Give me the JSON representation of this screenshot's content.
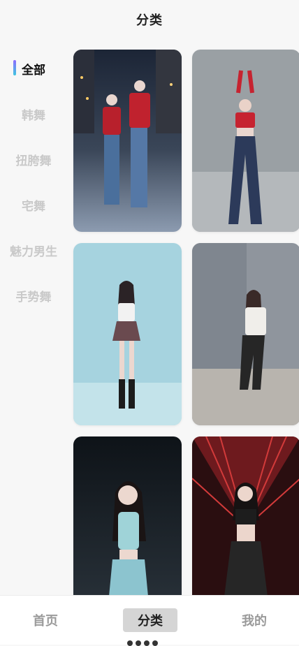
{
  "header": {
    "title": "分类"
  },
  "sidebar": {
    "items": [
      {
        "label": "全部",
        "active": true
      },
      {
        "label": "韩舞",
        "active": false
      },
      {
        "label": "扭胯舞",
        "active": false
      },
      {
        "label": "宅舞",
        "active": false
      },
      {
        "label": "魅力男生",
        "active": false
      },
      {
        "label": "手势舞",
        "active": false
      }
    ]
  },
  "grid": {
    "cards": [
      {
        "scene": "two-dancers-street-night"
      },
      {
        "scene": "dancer-red-top-grey-wall"
      },
      {
        "scene": "dancer-plaid-skirt-blue-backdrop"
      },
      {
        "scene": "dancer-white-top-grey-room"
      },
      {
        "scene": "dancer-teal-outfit-dark-stage"
      },
      {
        "scene": "dancer-black-outfit-red-stage"
      }
    ]
  },
  "tabbar": {
    "tabs": [
      {
        "label": "首页",
        "active": false
      },
      {
        "label": "分类",
        "active": true
      },
      {
        "label": "我的",
        "active": false
      }
    ]
  },
  "colors": {
    "accent_gradient": [
      "#8e6bff",
      "#3ec6e0"
    ],
    "active_text": "#111111",
    "inactive_text": "#c9c9c9"
  }
}
